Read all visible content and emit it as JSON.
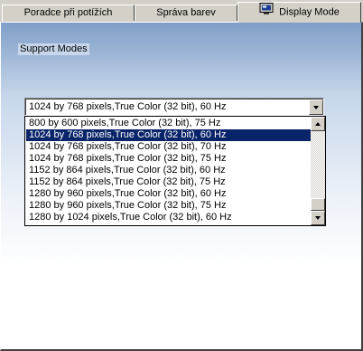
{
  "tabs": [
    {
      "label": "Poradce při potížích"
    },
    {
      "label": "Správa barev"
    },
    {
      "label": "Display Mode"
    }
  ],
  "group": {
    "label": "Support Modes"
  },
  "combo": {
    "value": "1024 by 768 pixels,True Color (32 bit), 60 Hz"
  },
  "options": [
    {
      "label": "800 by 600 pixels,True Color (32 bit), 75 Hz"
    },
    {
      "label": "1024 by 768 pixels,True Color (32 bit), 60 Hz"
    },
    {
      "label": "1024 by 768 pixels,True Color (32 bit), 70 Hz"
    },
    {
      "label": "1024 by 768 pixels,True Color (32 bit), 75 Hz"
    },
    {
      "label": "1152 by 864 pixels,True Color (32 bit), 60 Hz"
    },
    {
      "label": "1152 by 864 pixels,True Color (32 bit), 75 Hz"
    },
    {
      "label": "1280 by 960 pixels,True Color (32 bit), 60 Hz"
    },
    {
      "label": "1280 by 960 pixels,True Color (32 bit), 75 Hz"
    },
    {
      "label": "1280 by 1024 pixels,True Color (32 bit), 60 Hz"
    }
  ],
  "selected_index": 1,
  "colors": {
    "selection": "#0a246a",
    "face": "#d4d0c8"
  },
  "icons": {
    "active_tab": "monitor-icon"
  }
}
